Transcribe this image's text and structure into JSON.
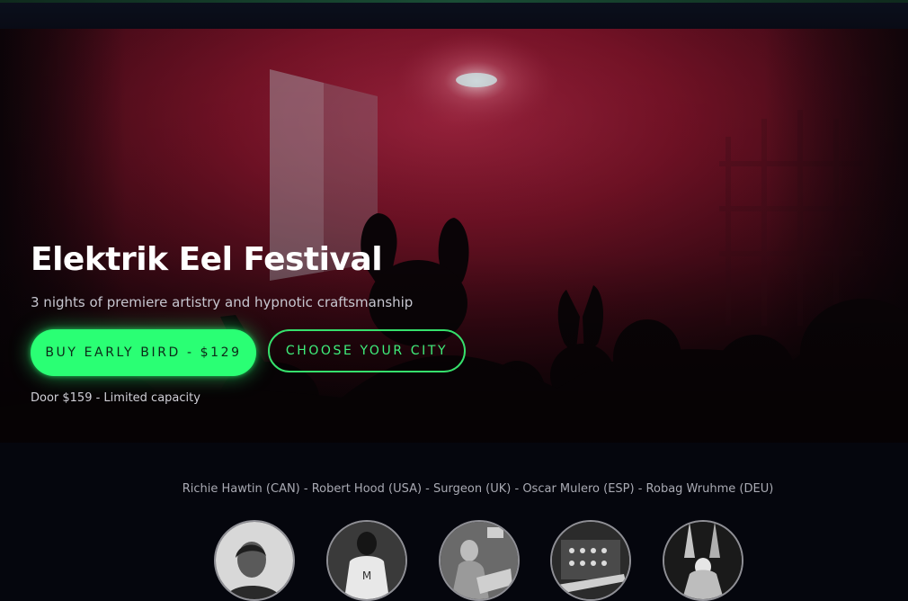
{
  "hero": {
    "title": "Elektrik Eel Festival",
    "subtitle": "3 nights of premiere artistry and hypnotic craftsmanship",
    "primary_button": "BUY EARLY BIRD - $129",
    "secondary_button": "CHOOSE YOUR CITY",
    "note": "Door $159 - Limited capacity"
  },
  "lineup": {
    "text": "Richie Hawtin (CAN) - Robert Hood (USA) - Surgeon (UK) - Oscar Mulero (ESP) - Robag Wruhme (DEU)",
    "artists": [
      {
        "name": "Richie Hawtin",
        "country": "CAN"
      },
      {
        "name": "Robert Hood",
        "country": "USA"
      },
      {
        "name": "Surgeon",
        "country": "UK"
      },
      {
        "name": "Oscar Mulero",
        "country": "ESP"
      },
      {
        "name": "Robag Wruhme",
        "country": "DEU"
      }
    ]
  },
  "colors": {
    "accent": "#2aff74",
    "background": "#05060d",
    "hero_tint": "#7a1022"
  }
}
